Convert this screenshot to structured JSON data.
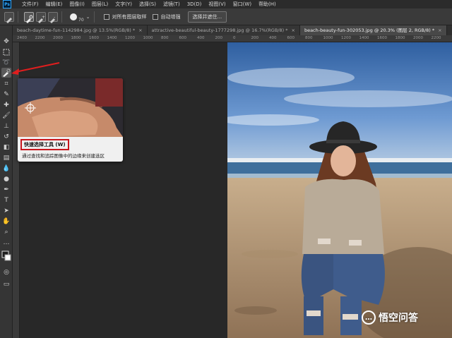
{
  "app": {
    "logo": "Ps"
  },
  "menu": [
    "文件(F)",
    "编辑(E)",
    "图像(I)",
    "图层(L)",
    "文字(Y)",
    "选择(S)",
    "滤镜(T)",
    "3D(D)",
    "视图(V)",
    "窗口(W)",
    "帮助(H)"
  ],
  "options": {
    "brush_size": "70",
    "sample_all_layers": "对所有图层取样",
    "auto_enhance": "自动增强",
    "select_and_mask": "选择并遮住..."
  },
  "tabs": [
    {
      "label": "beach-daytime-fun-1142984.jpg @ 13.5%(RGB/8) *",
      "close": "×",
      "active": false
    },
    {
      "label": "attractive-beautiful-beauty-1777298.jpg @ 16.7%(RGB/8) *",
      "close": "×",
      "active": false
    },
    {
      "label": "beach-beauty-fun-302053.jpg @ 20.3% (图层 2, RGB/8) *",
      "close": "×",
      "active": true
    }
  ],
  "ruler_ticks": [
    "2400",
    "2200",
    "2000",
    "1800",
    "1600",
    "1400",
    "1200",
    "1000",
    "800",
    "600",
    "400",
    "200",
    "0",
    "200",
    "400",
    "600",
    "800",
    "1000",
    "1200",
    "1400",
    "1600",
    "1800",
    "2000",
    "2200"
  ],
  "tools": [
    "move-icon",
    "marquee-icon",
    "lasso-icon",
    "quick-selection-icon",
    "crop-icon",
    "eyedropper-icon",
    "healing-icon",
    "brush-icon",
    "stamp-icon",
    "history-brush-icon",
    "eraser-icon",
    "gradient-icon",
    "blur-icon",
    "dodge-icon",
    "pen-icon",
    "type-icon",
    "path-select-icon",
    "hand-icon",
    "zoom-icon",
    "more-icon",
    "color-swatch-icon",
    "quick-mask-icon",
    "screen-mode-icon"
  ],
  "tooltip": {
    "title": "快速选择工具 (W)",
    "description": "通过查找和追踪图像中的边缘来创建选区"
  },
  "watermark": {
    "text": "悟空问答"
  },
  "colors": {
    "accent_red": "#c8161d",
    "arrow_red": "#e01e1e"
  }
}
